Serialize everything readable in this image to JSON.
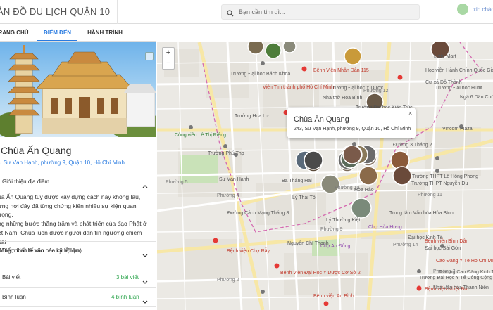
{
  "header": {
    "app_title": "ẢN ĐỒ DU LỊCH QUẬN 10",
    "search_placeholder": "Bạn cần tìm gì...",
    "greeting": "xin chào"
  },
  "tabs": [
    {
      "label": "RANG CHỦ"
    },
    {
      "label": "ĐIỂM ĐẾN"
    },
    {
      "label": "HÀNH TRÌNH"
    }
  ],
  "place": {
    "name": "Chùa Ấn Quang",
    "address": "3, Sư Vạn Hạnh, phường 9, Quận 10, Hồ Chí Minh",
    "intro_title": "Giới thiệu địa điểm",
    "intro_lines": [
      "ùa Ấn Quang tuy được xây dựng cách nay không lâu,",
      "ưng nơi đây đã từng chứng kiến nhiều sự kiện quan trọng,",
      "ng những bước thăng trầm và phát triển của đạo Phật ở",
      "ệt Nam. Chùa luôn được người dân tìn ngưỡng chiêm bái",
      "đông, nhất là vào các kỳ lễ lớn."
    ],
    "culture_title": "Điểm kinh tế văn hóa xã hội (m)",
    "articles_title": "Bài viết",
    "articles_count": "3 bài viết",
    "comments_title": "Bình luận",
    "comments_count": "4 bình luận"
  },
  "map": {
    "zoom_in": "+",
    "zoom_out": "−",
    "popup_name": "Chùa Ấn Quang",
    "popup_address": "243, Sư Vạn Hạnh, phường 9, Quận 10, Hồ Chí Minh",
    "popup_close": "×",
    "labels": [
      {
        "text": "Cao Đẳng Y Tế Hồ Chí Minh",
        "color": "#c0392b"
      },
      {
        "text": "Bệnh Viện Đại Học Y Dược Cơ Sở 2",
        "color": "#c0392b"
      },
      {
        "text": "Trường Đại học Bách Khoa",
        "color": "#555"
      },
      {
        "text": "Trường THPT Nguyễn Du",
        "color": "#555"
      },
      {
        "text": "Đại học Kinh Tế",
        "color": "#555"
      },
      {
        "text": "Chợ An Đông",
        "color": "#8e44ad"
      },
      {
        "text": "Bệnh viện An Bình",
        "color": "#c0392b"
      },
      {
        "text": "Bệnh Viện Nhân Dân 115",
        "color": "#c0392b"
      },
      {
        "text": "Bệnh viện Chợ Rẫy",
        "color": "#c0392b"
      },
      {
        "text": "Trường Phú Thọ",
        "color": "#555"
      },
      {
        "text": "Công viên Lê Thị Riêng",
        "color": "#2e7d32"
      },
      {
        "text": "Nhà thờ Hoa Bình",
        "color": "#555"
      },
      {
        "text": "Học viện Hành Chính Quốc Gia",
        "color": "#555"
      },
      {
        "text": "Trường THPT Lê Hồng Phong",
        "color": "#555"
      },
      {
        "text": "Bệnh viện Bình Dân",
        "color": "#c0392b"
      },
      {
        "text": "Cư xá Đô Thành",
        "color": "#555"
      },
      {
        "text": "Trường Cao Đẳng Kinh Tế Đối Ngoại",
        "color": "#555"
      },
      {
        "text": "Bệnh viện Nhiệt Đới",
        "color": "#c0392b"
      },
      {
        "text": "Đại học Sài Gòn",
        "color": "#555"
      },
      {
        "text": "Trung tâm Văn hóa Hòa Bình",
        "color": "#555"
      },
      {
        "text": "Chợ Hòa Hưng",
        "color": "#8e44ad"
      },
      {
        "text": "Đường Cách Mạng Tháng 8",
        "color": "#555"
      },
      {
        "text": "Trường Đại Học Y Tế Công Cộng",
        "color": "#555"
      },
      {
        "text": "Viện Tim thành phố Hồ Chí Minh",
        "color": "#c0392b"
      },
      {
        "text": "Phường 12",
        "color": "#777"
      },
      {
        "text": "Phường 5",
        "color": "#777"
      },
      {
        "text": "Phường 9",
        "color": "#777"
      },
      {
        "text": "Phường 10",
        "color": "#777"
      },
      {
        "text": "Phường 11",
        "color": "#777"
      },
      {
        "text": "Phường 2",
        "color": "#777"
      },
      {
        "text": "Phường 7",
        "color": "#777"
      },
      {
        "text": "Phường 4",
        "color": "#777"
      },
      {
        "text": "Phường 14",
        "color": "#777"
      },
      {
        "text": "Hòa Hảo",
        "color": "#555"
      },
      {
        "text": "Ba Tháng Hai",
        "color": "#555"
      },
      {
        "text": "Nguyễn Chí Thanh",
        "color": "#555"
      },
      {
        "text": "Lý Thái Tổ",
        "color": "#555"
      },
      {
        "text": "Sư Vạn Hạnh",
        "color": "#555"
      },
      {
        "text": "Trường Đại học Huflit",
        "color": "#555"
      },
      {
        "text": "Trường Nguyễn Hiền",
        "color": "#555"
      },
      {
        "text": "Trường Đại học Y Dược",
        "color": "#555"
      },
      {
        "text": "Lotte Mart",
        "color": "#555"
      },
      {
        "text": "Vincom Plaza",
        "color": "#555"
      },
      {
        "text": "Đường 3 Tháng 2",
        "color": "#555"
      },
      {
        "text": "Ngã 6 Dân Chủ",
        "color": "#555"
      },
      {
        "text": "Trường Hoa Lư",
        "color": "#555"
      },
      {
        "text": "Lý Thường Kiệt",
        "color": "#555"
      },
      {
        "text": "Trường Đại học Kiến Trúc",
        "color": "#555"
      },
      {
        "text": "Nhà Văn hóa Thanh Niên",
        "color": "#555"
      }
    ]
  }
}
